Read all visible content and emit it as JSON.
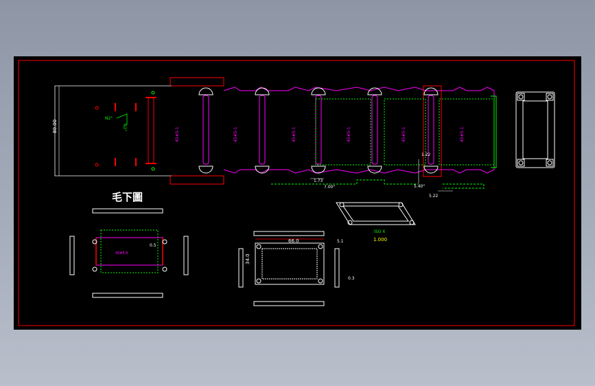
{
  "drawing": {
    "title": "毛下圖",
    "dim_height_strip": "80.00",
    "dim_a": "1.73",
    "dim_b": "7.00°",
    "dim_c": "1.22",
    "dim_d": "5.40°",
    "dim_e": "5.22",
    "dim_width": "66.0",
    "dim_height": "34.0",
    "dim_edge": "5.1",
    "dim_small": "0.3",
    "dim_offset": "0.5",
    "iso_label": "ISO X",
    "iso_scale": "1.000",
    "part_label": "45#5-1",
    "note_label": "N2°",
    "inner_label": "45#5-6"
  },
  "colors": {
    "background": "#000000",
    "border": "#ff0000",
    "magenta": "#ff00ff",
    "green": "#00ff00",
    "white": "#ffffff",
    "yellow": "#ffff00"
  }
}
